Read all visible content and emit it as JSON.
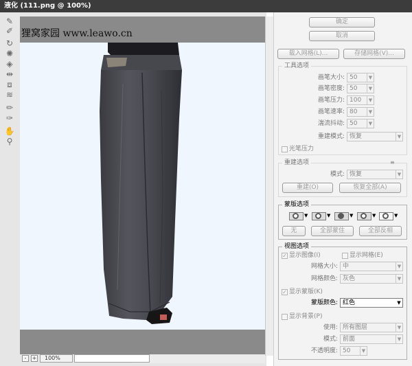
{
  "window": {
    "title": "液化 (111.png @ 100%)"
  },
  "toolbar": {
    "tools": [
      "forward-warp-icon",
      "reconstruct-icon",
      "twirl-icon",
      "pucker-icon",
      "bloat-icon",
      "push-left-icon",
      "mirror-icon",
      "turbulence-icon",
      "freeze-mask-icon",
      "thaw-mask-icon",
      "hand-icon",
      "zoom-icon"
    ]
  },
  "canvas": {
    "watermark": "狸窝家园 www.leawo.cn",
    "background_color": "#f0f6fe",
    "frame_color": "#8a8a8a"
  },
  "status": {
    "zoom_out": "-",
    "zoom_in": "+",
    "zoom_level": "100%"
  },
  "buttons": {
    "ok": "确定",
    "cancel": "取消",
    "load_mesh": "载入网格(L)...",
    "save_mesh": "存储网格(V)..."
  },
  "tool_options": {
    "title": "工具选项",
    "brush_size_label": "画笔大小:",
    "brush_size": "50",
    "brush_density_label": "画笔密度:",
    "brush_density": "50",
    "brush_pressure_label": "画笔压力:",
    "brush_pressure": "100",
    "brush_rate_label": "画笔速率:",
    "brush_rate": "80",
    "turbulent_jitter_label": "湍流抖动:",
    "turbulent_jitter": "50",
    "reconstruct_mode_label": "重建模式:",
    "reconstruct_mode": "恢复",
    "stylus_pressure": "光笔压力"
  },
  "reconstruct_options": {
    "title": "重建选项",
    "mode_label": "模式:",
    "mode": "恢复",
    "reconstruct_button": "重建(O)",
    "restore_all_button": "恢复全部(A)"
  },
  "mask_options": {
    "title": "蒙版选项",
    "operations": [
      "replace-selection-icon",
      "add-to-selection-icon",
      "subtract-from-selection-icon",
      "intersect-selection-icon",
      "invert-selection-icon"
    ],
    "none_button": "无",
    "mask_all_button": "全部蒙住",
    "invert_all_button": "全部反相"
  },
  "view_options": {
    "title": "视图选项",
    "show_image": "显示图像(I)",
    "show_mesh": "显示网格(E)",
    "mesh_size_label": "网格大小:",
    "mesh_size": "中",
    "mesh_color_label": "网格颜色:",
    "mesh_color": "灰色",
    "show_mask": "显示蒙版(K)",
    "mask_color_label": "蒙版颜色:",
    "mask_color": "红色",
    "show_backdrop": "显示背景(P)",
    "use_label": "使用:",
    "use": "所有图层",
    "mode_label": "模式:",
    "mode": "前面",
    "opacity_label": "不透明度:",
    "opacity": "50"
  }
}
